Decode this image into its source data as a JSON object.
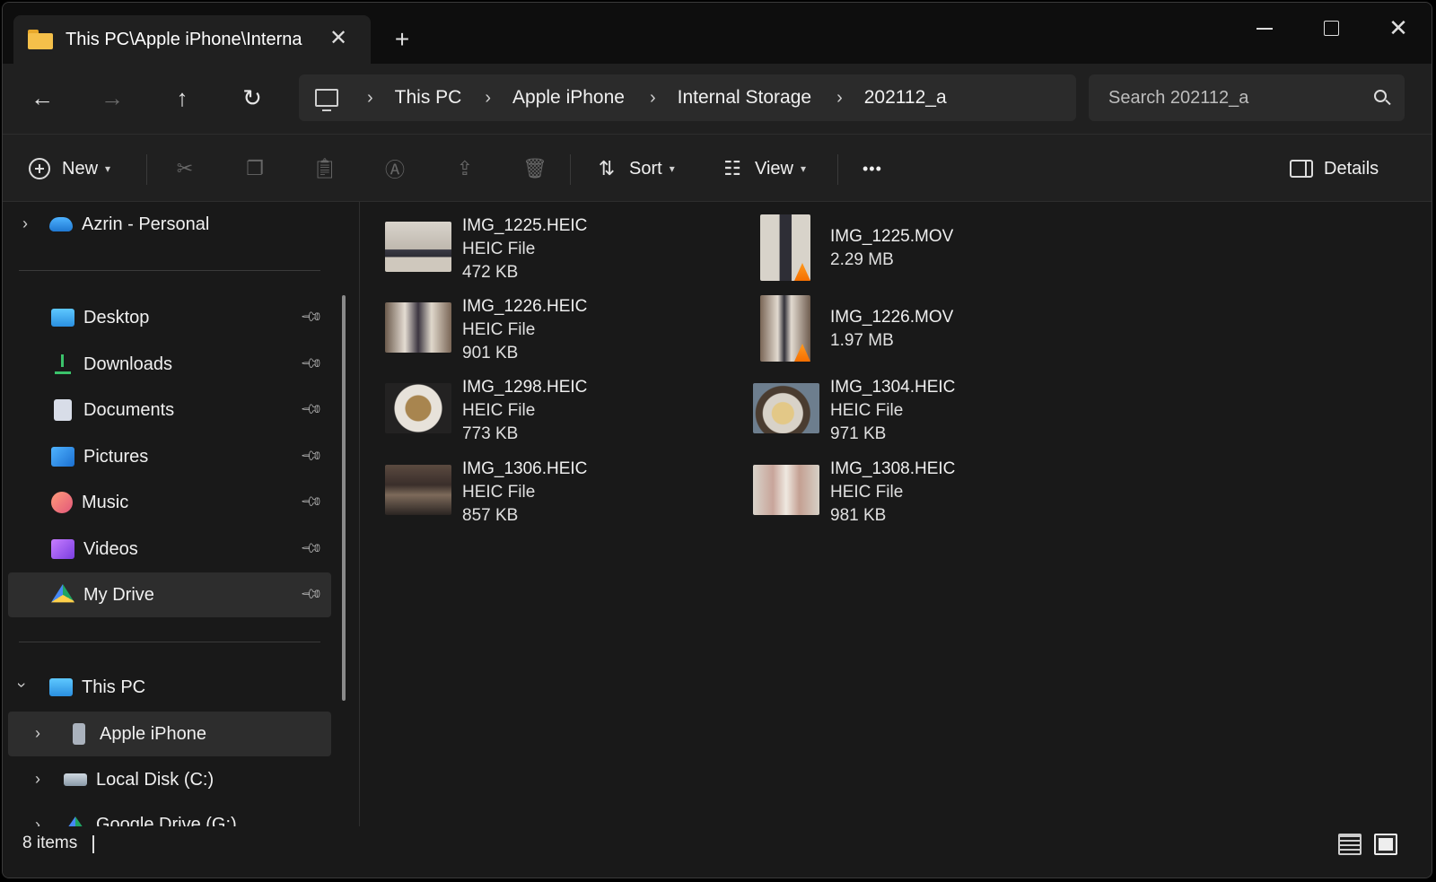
{
  "tab": {
    "title": "This PC\\Apple iPhone\\Interna",
    "close": "✕",
    "new_tab": "+"
  },
  "window_controls": {
    "minimize": "",
    "maximize": "",
    "close": "✕"
  },
  "nav": {
    "back": "←",
    "forward": "→",
    "up": "↑",
    "refresh": "↻"
  },
  "breadcrumb": [
    "This PC",
    "Apple iPhone",
    "Internal Storage",
    "202112_a"
  ],
  "breadcrumb_sep": "›",
  "search": {
    "placeholder": "Search 202112_a"
  },
  "commands": {
    "new_label": "New",
    "sort_label": "Sort",
    "view_label": "View",
    "more": "•••",
    "details_label": "Details",
    "icons": [
      "cut-icon",
      "copy-icon",
      "paste-icon",
      "rename-icon",
      "share-icon",
      "delete-icon"
    ]
  },
  "sidebar": {
    "onedrive": "Azrin - Personal",
    "quick_access": [
      {
        "label": "Desktop",
        "icon": "desktop-icon"
      },
      {
        "label": "Downloads",
        "icon": "downloads-icon"
      },
      {
        "label": "Documents",
        "icon": "documents-icon"
      },
      {
        "label": "Pictures",
        "icon": "pictures-icon"
      },
      {
        "label": "Music",
        "icon": "music-icon"
      },
      {
        "label": "Videos",
        "icon": "videos-icon"
      },
      {
        "label": "My Drive",
        "icon": "google-drive-icon"
      }
    ],
    "this_pc": "This PC",
    "drives": [
      {
        "label": "Apple iPhone",
        "icon": "iphone-icon"
      },
      {
        "label": "Local Disk (C:)",
        "icon": "disk-icon"
      },
      {
        "label": "Google Drive (G:)",
        "icon": "google-drive-icon"
      }
    ]
  },
  "files": [
    {
      "name": "IMG_1225.HEIC",
      "type": "HEIC File",
      "size": "472 KB"
    },
    {
      "name": "IMG_1225.MOV",
      "type": "",
      "size": "2.29 MB"
    },
    {
      "name": "IMG_1226.HEIC",
      "type": "HEIC File",
      "size": "901 KB"
    },
    {
      "name": "IMG_1226.MOV",
      "type": "",
      "size": "1.97 MB"
    },
    {
      "name": "IMG_1298.HEIC",
      "type": "HEIC File",
      "size": "773 KB"
    },
    {
      "name": "IMG_1304.HEIC",
      "type": "HEIC File",
      "size": "971 KB"
    },
    {
      "name": "IMG_1306.HEIC",
      "type": "HEIC File",
      "size": "857 KB"
    },
    {
      "name": "IMG_1308.HEIC",
      "type": "HEIC File",
      "size": "981 KB"
    }
  ],
  "status": {
    "count": "8 items"
  }
}
